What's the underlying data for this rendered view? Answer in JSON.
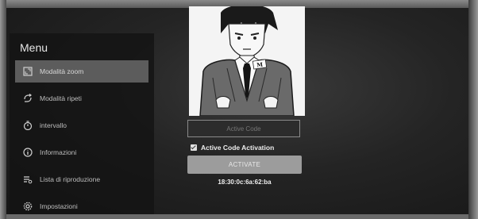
{
  "menu": {
    "title": "Menu",
    "items": [
      {
        "label": "Modalità zoom",
        "icon": "zoom-icon",
        "selected": true
      },
      {
        "label": "Modalità ripeti",
        "icon": "repeat-icon",
        "selected": false
      },
      {
        "label": "intervallo",
        "icon": "timer-icon",
        "selected": false
      },
      {
        "label": "Informazioni",
        "icon": "info-icon",
        "selected": false
      },
      {
        "label": "Lista di riproduzione",
        "icon": "playlist-icon",
        "selected": false
      },
      {
        "label": "Impostazioni",
        "icon": "settings-icon",
        "selected": false
      }
    ]
  },
  "illustration": {
    "badge_text": "M"
  },
  "activation": {
    "code_placeholder": "Active Code",
    "checkbox_label": "Active Code Activation",
    "checkbox_checked": true,
    "button_label": "ACTIVATE",
    "mac_address": "18:30:0c:6a:62:ba"
  }
}
